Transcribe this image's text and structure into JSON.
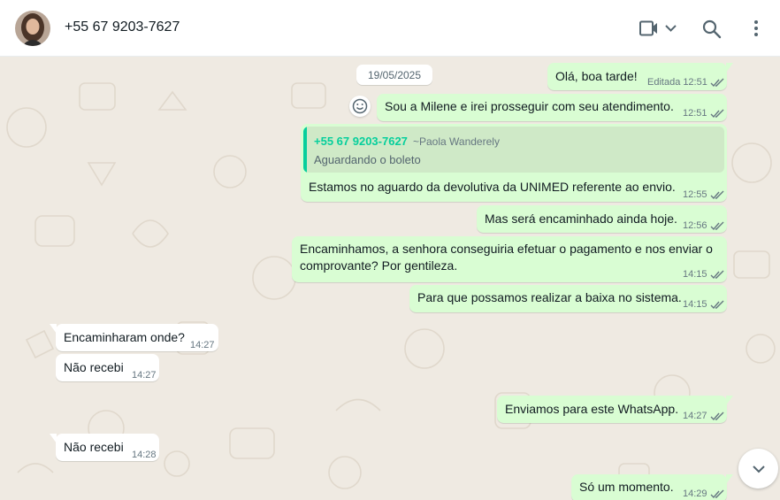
{
  "header": {
    "contact_name": "+55 67 9203-7627"
  },
  "icons": {
    "video_call": "video-camera-icon",
    "dropdown": "chevron-down-icon",
    "search": "search-icon",
    "menu": "kebab-menu-icon",
    "emoji": "emoji-icon",
    "scroll_down": "chevron-down-icon"
  },
  "colors": {
    "outgoing_bubble": "#d9fdd3",
    "incoming_bubble": "#ffffff",
    "chat_background": "#efeae2",
    "read_ticks": "#53bdeb",
    "quote_accent": "#06cf9c"
  },
  "chat": {
    "date_label": "19/05/2025",
    "messages": [
      {
        "direction": "out",
        "text": "Olá, boa tarde!",
        "edited_label": "Editada",
        "time": "12:51"
      },
      {
        "direction": "out",
        "text": "Sou a Milene e irei prosseguir com seu atendimento.",
        "time": "12:51"
      },
      {
        "direction": "out",
        "quote": {
          "phone": "+55 67 9203-7627",
          "author": "~Paola Wanderely",
          "text": "Aguardando o boleto"
        },
        "text": "Estamos no aguardo da devolutiva da UNIMED referente ao envio.",
        "time": "12:55"
      },
      {
        "direction": "out",
        "text": "Mas será encaminhado ainda hoje.",
        "time": "12:56"
      },
      {
        "direction": "out",
        "text_line1": "Encaminhamos, a senhora conseguiria efetuar o pagamento e nos enviar o",
        "text_line2": "comprovante? Por gentileza.",
        "time": "14:15"
      },
      {
        "direction": "out",
        "text": "Para que possamos realizar a baixa no sistema.",
        "time": "14:15"
      },
      {
        "direction": "in",
        "text": "Encaminharam onde?",
        "time": "14:27"
      },
      {
        "direction": "in",
        "text": "Não recebi",
        "time": "14:27"
      },
      {
        "direction": "out",
        "text": "Enviamos para este WhatsApp.",
        "time": "14:27"
      },
      {
        "direction": "in",
        "text": "Não recebi",
        "time": "14:28"
      },
      {
        "direction": "out",
        "text": "Só um momento.",
        "time": "14:29"
      }
    ]
  }
}
